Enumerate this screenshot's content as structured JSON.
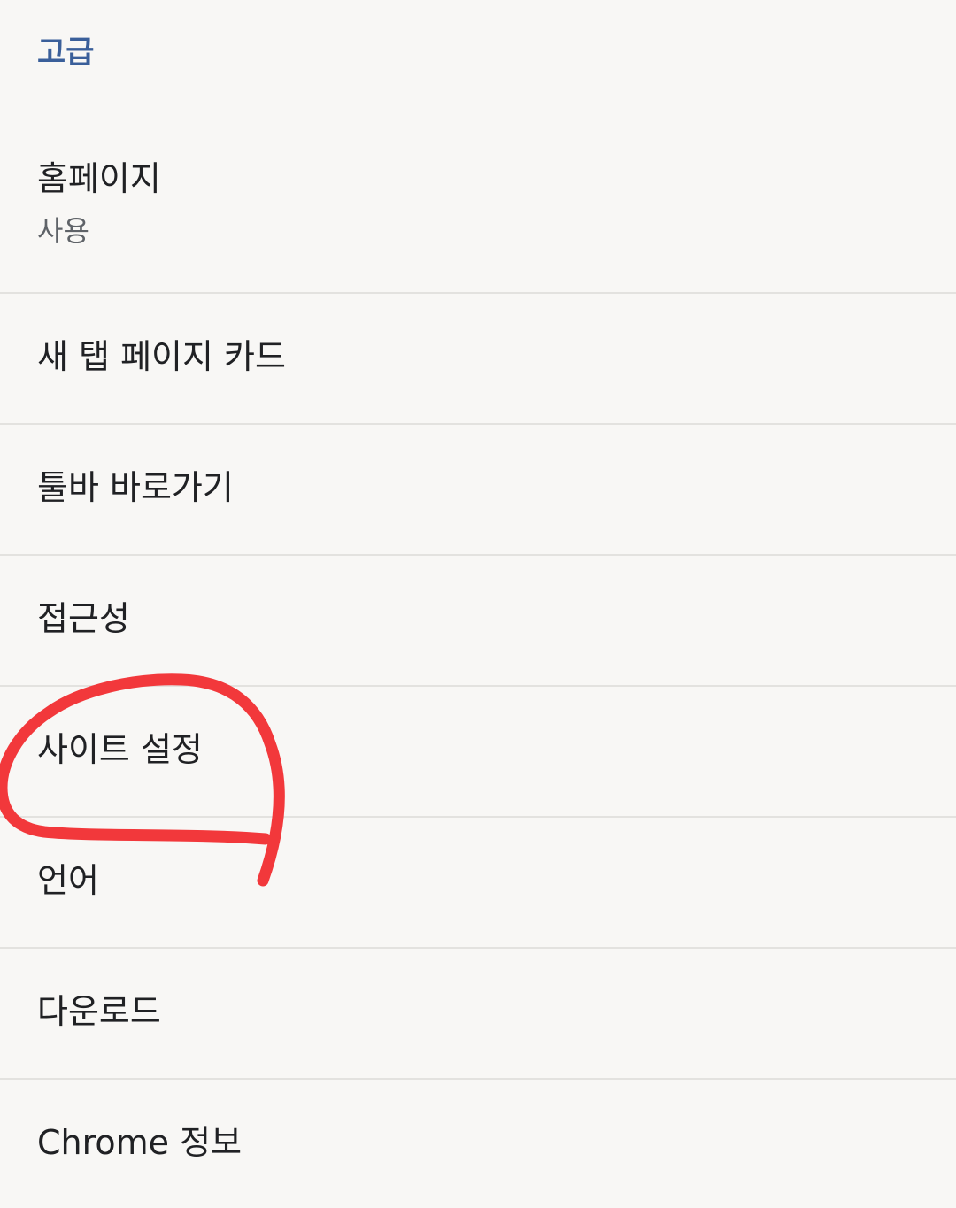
{
  "section": {
    "header": "고급"
  },
  "items": [
    {
      "title": "홈페이지",
      "subtitle": "사용"
    },
    {
      "title": "새 탭 페이지 카드"
    },
    {
      "title": "툴바 바로가기"
    },
    {
      "title": "접근성"
    },
    {
      "title": "사이트 설정"
    },
    {
      "title": "언어"
    },
    {
      "title": "다운로드"
    },
    {
      "title": "Chrome 정보"
    }
  ],
  "colors": {
    "background": "#f8f7f5",
    "header_accent": "#3a5f9a",
    "annotation_stroke": "#f2383b",
    "divider": "#e3e2df"
  }
}
